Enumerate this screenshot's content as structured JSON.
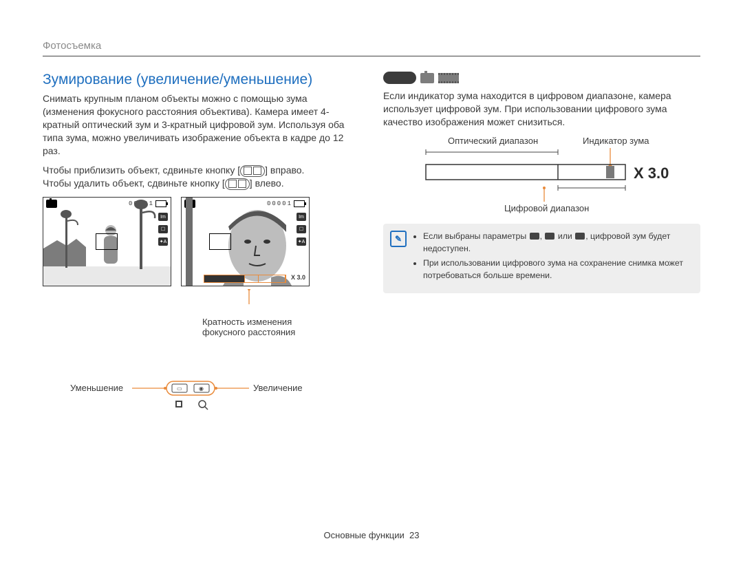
{
  "header": {
    "section": "Фотосъемка"
  },
  "title": "Зумирование (увеличение/уменьшение)",
  "left": {
    "para1": "Снимать крупным планом объекты можно с помощью зума (изменения фокусного расстояния объектива). Камера имеет 4-кратный оптический зум и 3-кратный цифровой зум. Используя оба типа зума, можно увеличивать изображение объекта в кадре до 12 раз.",
    "para2_a": "Чтобы приблизить объект, сдвиньте кнопку [",
    "para2_b": "] вправо.",
    "para3_a": "Чтобы удалить объект, сдвиньте кнопку [",
    "para3_b": "] влево.",
    "lcd_counter": "00001",
    "side_icon_top": "Im",
    "side_icon_mid": "☐",
    "side_icon_bot": "✦A",
    "zoom_readout": "X 3.0",
    "focal_caption": "Кратность изменения фокусного расстояния",
    "zoom_out_label": "Уменьшение",
    "zoom_in_label": "Увеличение"
  },
  "right": {
    "mode_pill": "",
    "para": "Если индикатор зума находится в цифровом диапазоне, камера использует цифровой зум. При использовании цифрового зума качество изображения может снизиться.",
    "label_optical": "Оптический диапазон",
    "label_indicator": "Индикатор зума",
    "label_digital": "Цифровой диапазон",
    "big_readout": "X 3.0",
    "note1_a": "Если выбраны параметры ",
    "note1_b": ", ",
    "note1_c": " или ",
    "note1_d": ", цифровой зум будет недоступен.",
    "note2": "При использовании цифрового зума на сохранение снимка может потребоваться больше времени."
  },
  "footer": {
    "chapter": "Основные функции",
    "page": "23"
  }
}
